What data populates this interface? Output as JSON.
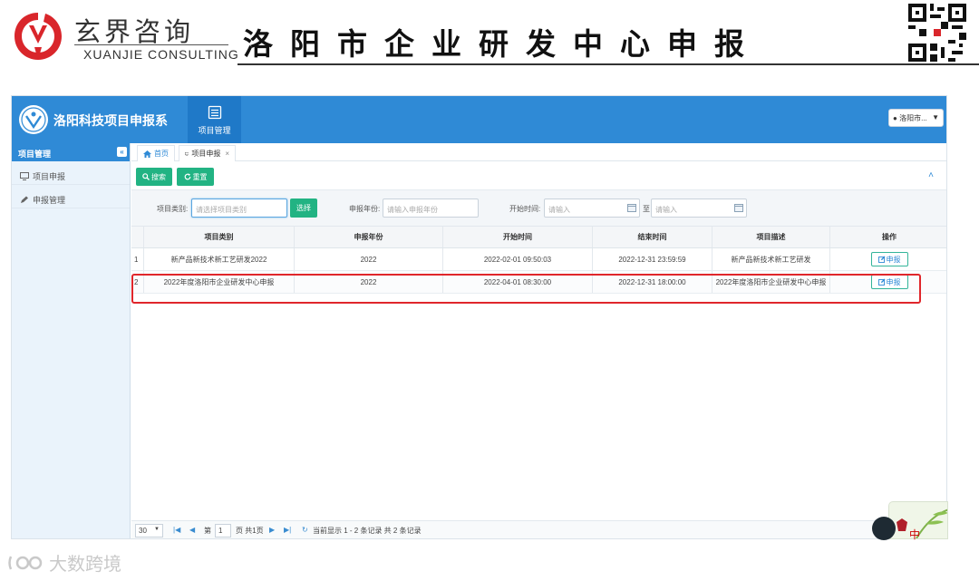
{
  "banner": {
    "brand_cn": "玄界咨询",
    "brand_en": "XUANJIE CONSULTING",
    "title": "洛阳市企业研发中心申报"
  },
  "app": {
    "title": "洛阳科技项目申报系",
    "top_nav_label": "项目管理",
    "user_menu": "洛阳市..."
  },
  "sidebar": {
    "header": "项目管理",
    "items": [
      {
        "label": "项目申报",
        "icon": "monitor-icon"
      },
      {
        "label": "申报管理",
        "icon": "pencil-icon"
      }
    ]
  },
  "tabs": [
    {
      "label": "首页"
    },
    {
      "label": "项目申报"
    }
  ],
  "toolbar": {
    "search_label": "搜索",
    "reset_label": "重置"
  },
  "filter": {
    "category_label": "项目类别:",
    "category_placeholder": "请选择项目类别",
    "choose_label": "选择",
    "year_label": "申报年份:",
    "year_placeholder": "请输入申报年份",
    "start_label": "开始时间:",
    "start_placeholder": "请输入",
    "to_label": "至",
    "end_placeholder": "请输入"
  },
  "grid": {
    "columns": [
      "项目类别",
      "申报年份",
      "开始时间",
      "结束时间",
      "项目描述",
      "操作"
    ],
    "rows": [
      {
        "no": "1",
        "category": "新产品新技术新工艺研发2022",
        "year": "2022",
        "start": "2022-02-01 09:50:03",
        "end": "2022-12-31 23:59:59",
        "desc": "新产品新技术新工艺研发",
        "action": "申报"
      },
      {
        "no": "2",
        "category": "2022年度洛阳市企业研发中心申报",
        "year": "2022",
        "start": "2022-04-01 08:30:00",
        "end": "2022-12-31 18:00:00",
        "desc": "2022年度洛阳市企业研发中心申报",
        "action": "申报"
      }
    ]
  },
  "pager": {
    "page_size": "30",
    "page_prefix": "第",
    "page_value": "1",
    "page_suffix": "页 共1页",
    "summary": "当前显示 1 - 2 条记录 共 2 条记录"
  },
  "float": {
    "char": "中"
  },
  "watermark": {
    "text": "大数跨境"
  },
  "colors": {
    "primary": "#2f8ad6",
    "green": "#22b383",
    "highlight": "#e0262b"
  }
}
